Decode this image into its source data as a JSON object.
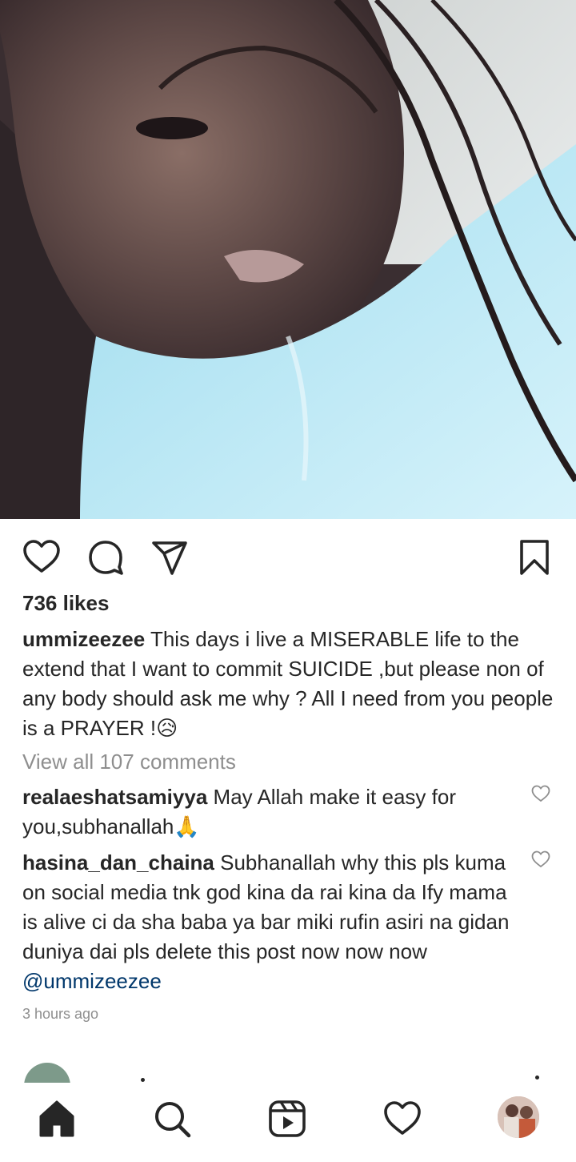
{
  "post": {
    "image_alt": "Close-up selfie photo",
    "likes_text": "736 likes",
    "author": "ummizeezee",
    "caption": "This days i live a MISERABLE life to the extend that I want to commit SUICIDE ,but please non of any body should ask me why ? All I need from you people is a PRAYER !",
    "caption_emoji": "😥",
    "view_all_comments": "View all 107 comments",
    "time_ago": "3 hours ago"
  },
  "comments": [
    {
      "username": "realaeshatsamiyya",
      "text": "May Allah make it easy for you,subhanallah",
      "emoji": "🙏"
    },
    {
      "username": "hasina_dan_chaina",
      "text": "Subhanallah why this pls kuma on social media tnk god kina da rai kina da Ify mama is alive ci da sha baba ya bar miki rufin asiri na gidan duniya dai pls delete this post now now now",
      "mention": "@ummizeezee"
    }
  ],
  "icons": {
    "like": "heart-outline-icon",
    "comment": "comment-bubble-icon",
    "share": "paper-plane-icon",
    "save": "bookmark-icon",
    "home": "home-icon",
    "search": "search-icon",
    "reels": "reels-icon",
    "activity": "heart-outline-icon",
    "profile": "profile-avatar"
  },
  "colors": {
    "text": "#262626",
    "secondary": "#8e8e8e",
    "mention": "#00376b"
  }
}
